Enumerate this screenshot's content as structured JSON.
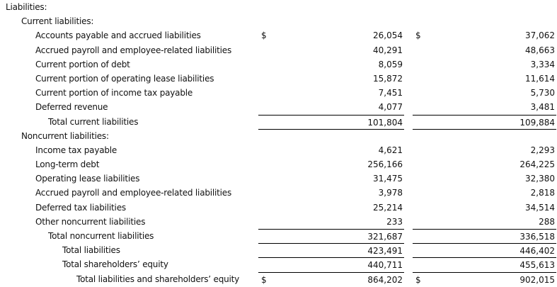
{
  "currency_symbol": "$",
  "rows": [
    {
      "label": "Liabilities:",
      "indent": 0
    },
    {
      "label": "Current liabilities:",
      "indent": 1
    },
    {
      "label": "Accounts payable and accrued liabilities",
      "indent": 2,
      "v1": "26,054",
      "v2": "37,062",
      "cur": true
    },
    {
      "label": "Accrued payroll and employee-related liabilities",
      "indent": 2,
      "v1": "40,291",
      "v2": "48,663"
    },
    {
      "label": "Current portion of debt",
      "indent": 2,
      "v1": "8,059",
      "v2": "3,334"
    },
    {
      "label": "Current portion of operating lease liabilities",
      "indent": 2,
      "v1": "15,872",
      "v2": "11,614"
    },
    {
      "label": "Current portion of income tax payable",
      "indent": 2,
      "v1": "7,451",
      "v2": "5,730"
    },
    {
      "label": "Deferred revenue",
      "indent": 2,
      "v1": "4,077",
      "v2": "3,481"
    },
    {
      "label": "Total current liabilities",
      "indent": 3,
      "v1": "101,804",
      "v2": "109,884",
      "line": true
    },
    {
      "label": "Noncurrent liabilities:",
      "indent": 1,
      "line": true,
      "blank": true
    },
    {
      "label": "Income tax payable",
      "indent": 2,
      "v1": "4,621",
      "v2": "2,293"
    },
    {
      "label": "Long-term debt",
      "indent": 2,
      "v1": "256,166",
      "v2": "264,225"
    },
    {
      "label": "Operating lease liabilities",
      "indent": 2,
      "v1": "31,475",
      "v2": "32,380"
    },
    {
      "label": "Accrued payroll and employee-related liabilities",
      "indent": 2,
      "v1": "3,978",
      "v2": "2,818"
    },
    {
      "label": "Deferred tax liabilities",
      "indent": 2,
      "v1": "25,214",
      "v2": "34,514"
    },
    {
      "label": "Other noncurrent liabilities",
      "indent": 2,
      "v1": "233",
      "v2": "288"
    },
    {
      "label": "Total noncurrent liabilities",
      "indent": 3,
      "v1": "321,687",
      "v2": "336,518",
      "line": true
    },
    {
      "label": "Total liabilities",
      "indent": 4,
      "v1": "423,491",
      "v2": "446,402",
      "line": true
    },
    {
      "label": "Total shareholders’ equity",
      "indent": 4,
      "v1": "440,711",
      "v2": "455,613",
      "line": true
    },
    {
      "label": "Total liabilities and shareholders’ equity",
      "indent": 5,
      "v1": "864,202",
      "v2": "902,015",
      "line": true,
      "cur": true
    }
  ]
}
